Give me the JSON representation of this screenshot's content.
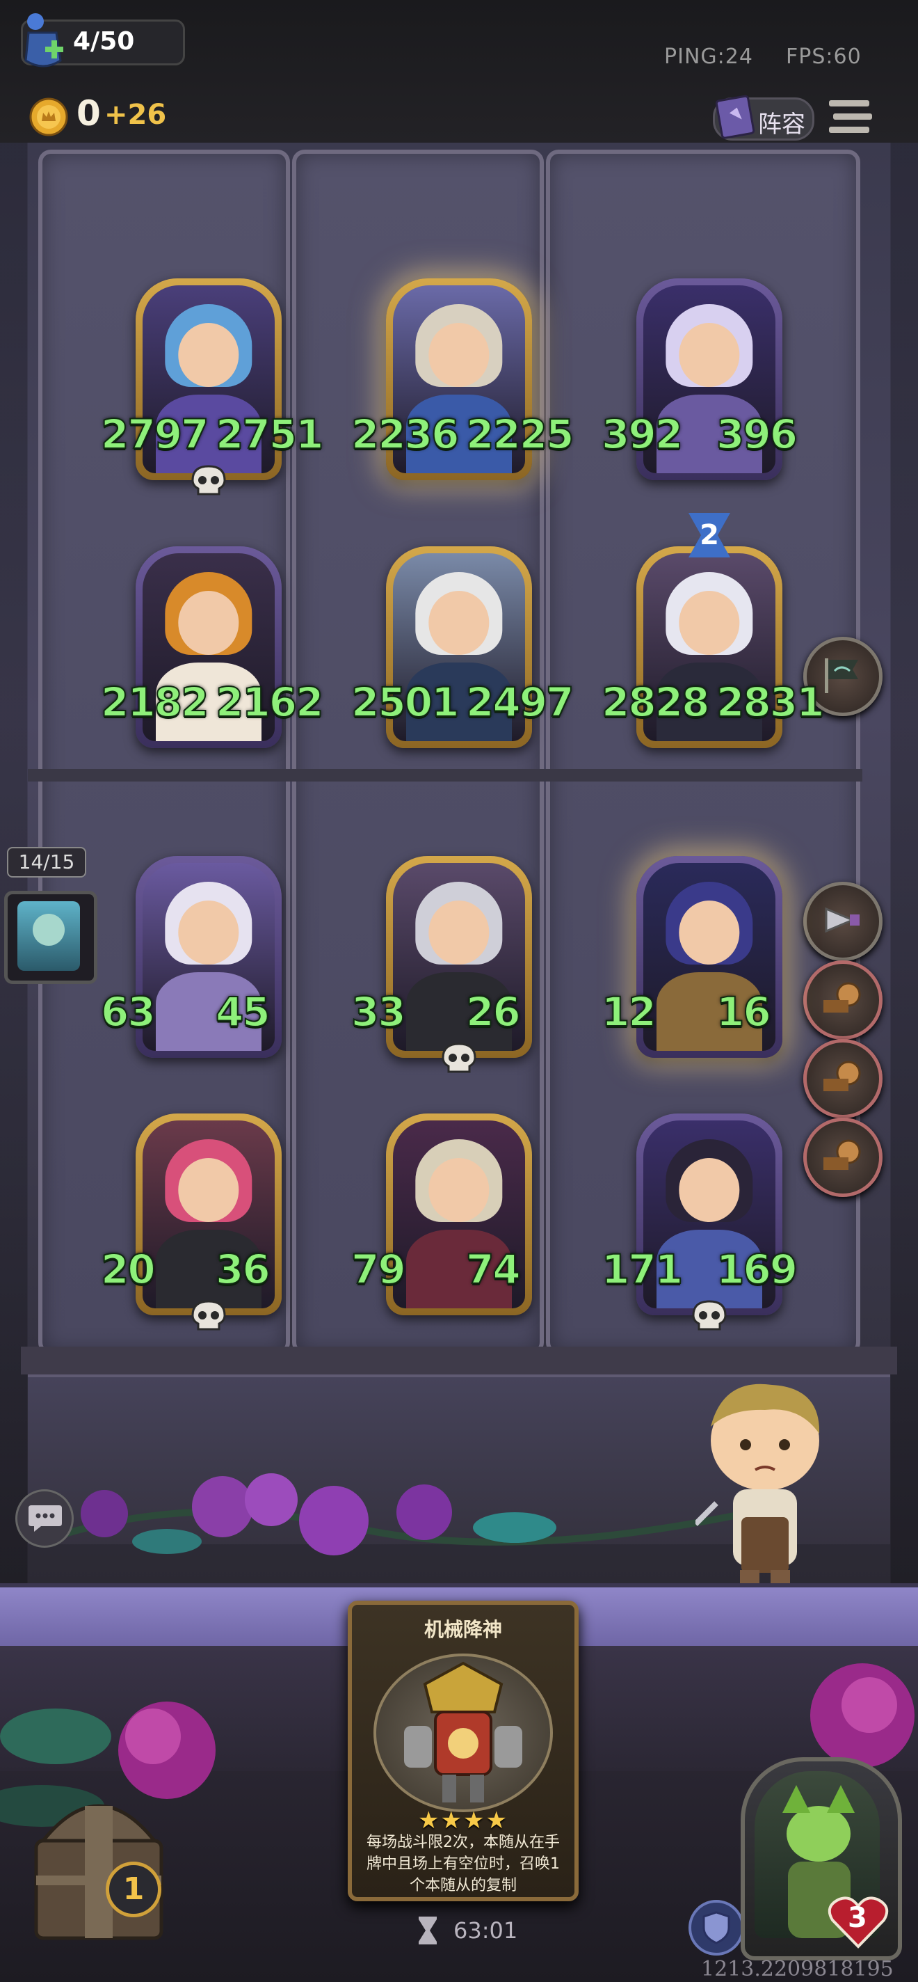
{
  "hud": {
    "population": "4/50",
    "ping": "PING:24",
    "fps": "FPS:60",
    "gold": "0",
    "gold_income": "+26",
    "lineup_label": "阵容"
  },
  "board": {
    "units": [
      {
        "attack": "2797",
        "health": "2751",
        "frame": "gold",
        "skull": true,
        "name_icon": "blue-hair-sorceress"
      },
      {
        "attack": "2236",
        "health": "2225",
        "frame": "gold",
        "glow": true,
        "name_icon": "bearded-king"
      },
      {
        "attack": "392",
        "health": "396",
        "frame": "purple",
        "name_icon": "horned-warrior"
      },
      {
        "attack": "2182",
        "health": "2162",
        "frame": "purple",
        "name_icon": "pumpkin-head"
      },
      {
        "attack": "2501",
        "health": "2497",
        "frame": "gold",
        "name_icon": "old-butler"
      },
      {
        "attack": "2828",
        "health": "2831",
        "frame": "gold",
        "badge": "2",
        "name_icon": "white-hair-nun"
      },
      {
        "attack": "63",
        "health": "45",
        "frame": "purple",
        "name_icon": "silver-hair-maiden"
      },
      {
        "attack": "33",
        "health": "26",
        "frame": "gold",
        "skull": true,
        "name_icon": "eyepatch-girl"
      },
      {
        "attack": "12",
        "health": "16",
        "frame": "purple",
        "glow": true,
        "name_icon": "mech-robot"
      },
      {
        "attack": "20",
        "health": "36",
        "frame": "gold",
        "skull": true,
        "name_icon": "red-hair-lady"
      },
      {
        "attack": "79",
        "health": "74",
        "frame": "gold",
        "name_icon": "skeleton-reaper"
      },
      {
        "attack": "171",
        "health": "169",
        "frame": "purple",
        "skull": true,
        "name_icon": "dark-hair-lady"
      }
    ],
    "bench_count": "14/15"
  },
  "card": {
    "title": "机械降神",
    "stars": "★★★★",
    "description": "每场战斗限2次，本随从在手牌中且场上有空位时，召唤1个本随从的复制"
  },
  "footer": {
    "timer": "63:01",
    "chest_count": "1",
    "hero_health": "3",
    "player_id": "1213.2209818195"
  },
  "colors": {
    "stat_green": "#8ef07a",
    "gold": "#f0c24a",
    "frame_gold": "#d4a84a",
    "frame_purple": "#6b5a9a"
  }
}
